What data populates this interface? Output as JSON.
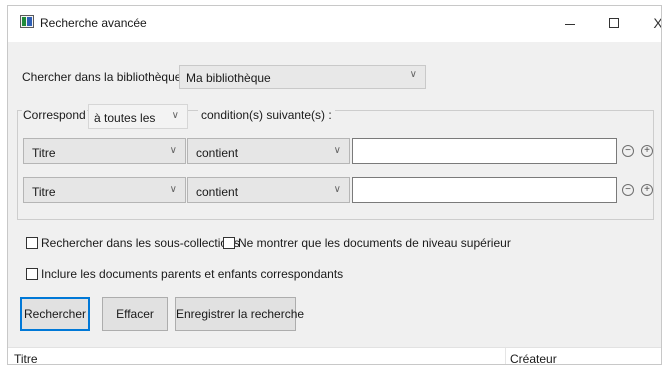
{
  "window": {
    "title": "Recherche avancée",
    "controls": [
      "minimize",
      "maximize",
      "close"
    ],
    "close_glyph": "X"
  },
  "library": {
    "label": "Chercher dans la bibliothèque :",
    "selected": "Ma bibliothèque"
  },
  "match": {
    "label": "Correspond",
    "selected": "à toutes les",
    "suffix": "condition(s) suivante(s) :"
  },
  "conditions": [
    {
      "field": "Titre",
      "operator": "contient",
      "value": ""
    },
    {
      "field": "Titre",
      "operator": "contient",
      "value": ""
    }
  ],
  "options": {
    "subcollections": {
      "label": "Rechercher dans les sous-collections",
      "checked": false
    },
    "top_level_only": {
      "label": "Ne montrer que les documents de niveau supérieur",
      "checked": false
    },
    "include_parents": {
      "label": "Inclure les documents parents et enfants correspondants",
      "checked": false
    }
  },
  "buttons": {
    "search": "Rechercher",
    "clear": "Effacer",
    "save": "Enregistrer la recherche"
  },
  "results": {
    "columns": [
      "Titre",
      "Créateur"
    ]
  },
  "icons": {
    "dropdown": "chevron-down-icon",
    "remove": "minus-icon",
    "add": "plus-icon"
  },
  "colors": {
    "focus_border": "#0078d7",
    "window_bg": "#f0f0f0",
    "combo_bg": "#e6e6e6"
  }
}
